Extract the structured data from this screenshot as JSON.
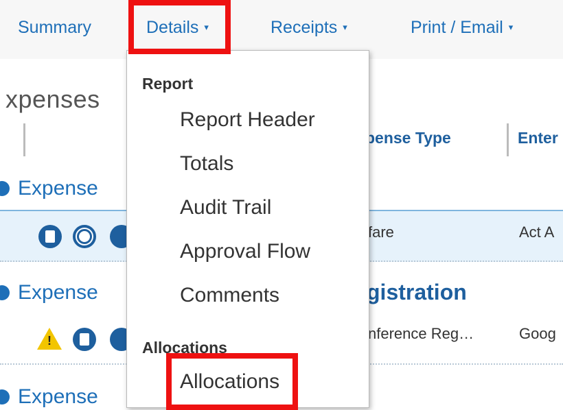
{
  "nav": {
    "items": [
      {
        "label": "Summary"
      },
      {
        "label": "Details"
      },
      {
        "label": "Receipts"
      },
      {
        "label": "Print / Email"
      }
    ],
    "caret": "▾"
  },
  "page": {
    "title": "xpenses",
    "columns": [
      "pense Type",
      "Enter"
    ],
    "groups": [
      "Expense",
      "Expense",
      "Expense"
    ],
    "rows": [
      {
        "type": "fare",
        "enter": "Act A"
      },
      {
        "type": "nference Reg…",
        "enter": "Goog"
      }
    ],
    "subheading": "gistration"
  },
  "menu": {
    "sections": [
      {
        "label": "Report",
        "items": [
          "Report Header",
          "Totals",
          "Audit Trail",
          "Approval Flow",
          "Comments"
        ]
      },
      {
        "label": "Allocations",
        "items": [
          "Allocations"
        ]
      }
    ]
  },
  "icons": {
    "row1": [
      "receipt-icon",
      "allocation-pie-icon",
      "comment-icon"
    ],
    "row2": [
      "warning-icon",
      "receipt-icon",
      "comment-icon"
    ]
  },
  "colors": {
    "link": "#1e6fb8",
    "heading": "#1e5f9e",
    "highlight": "#ee1111",
    "selected_row": "#e6f2fb"
  }
}
